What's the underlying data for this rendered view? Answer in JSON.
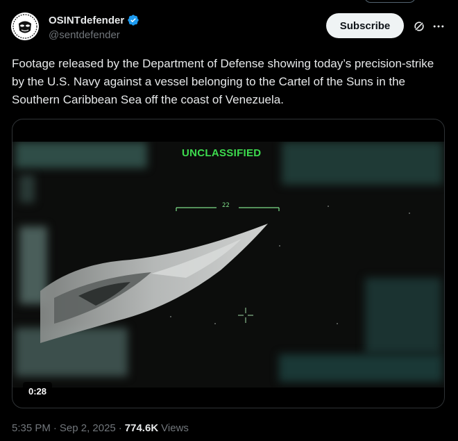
{
  "author": {
    "display_name": "OSINTdefender",
    "handle": "@sentdefender",
    "verified": true,
    "avatar_icon": "osint-mask-icon"
  },
  "actions": {
    "subscribe_label": "Subscribe",
    "grok_icon": "grok-icon",
    "more_icon": "more-horizontal-icon"
  },
  "tweet": {
    "text": "Footage released by the Department of Defense showing today’s precision-strike by the U.S. Navy against a vessel belonging to the Cartel of the Suns in the Southern Caribbean Sea off the coast of Venezuela."
  },
  "media": {
    "overlay_label": "UNCLASSIFIED",
    "reticle_value": "22",
    "duration": "0:28",
    "accent_color": "#3ddc4e"
  },
  "meta": {
    "time": "5:35 PM",
    "separator": "·",
    "date": "Sep 2, 2025",
    "views_count": "774.6K",
    "views_label": "Views"
  },
  "colors": {
    "background": "#000000",
    "text_primary": "#e7e9ea",
    "text_secondary": "#71767b",
    "verified_blue": "#1d9bf0",
    "button_bg": "#eff3f4"
  }
}
